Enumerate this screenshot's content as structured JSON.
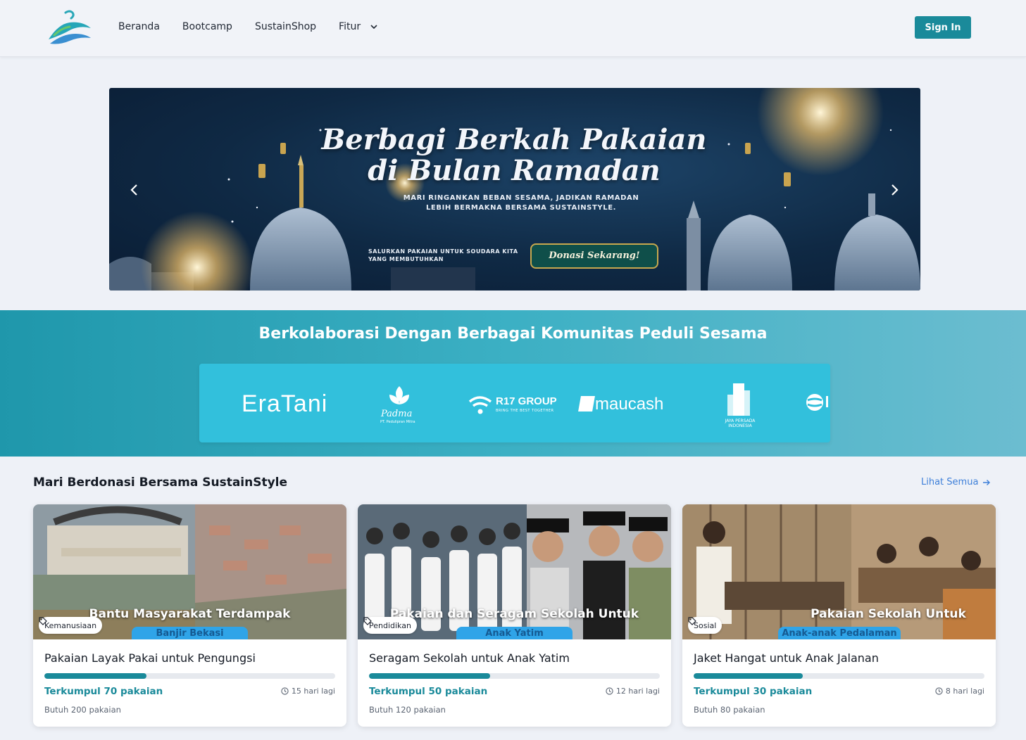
{
  "nav": {
    "links": [
      "Beranda",
      "Bootcamp",
      "SustainShop"
    ],
    "dropdown": "Fitur",
    "signin": "Sign In",
    "brand_color": "#1a8a9a"
  },
  "banner": {
    "title": "Berbagi Berkah Pakaian di Bulan Ramadan",
    "subtitle": "MARI RINGANKAN BEBAN SESAMA, JADIKAN RAMADAN LEBIH BERMAKNA BERSAMA SUSTAINSTYLE.",
    "small_text": "SALURKAN PAKAIAN UNTUK SOUDARA KITA YANG MEMBUTUHKAN",
    "cta": "Donasi Sekarang!",
    "prev_icon": "chevron-left-icon",
    "next_icon": "chevron-right-icon"
  },
  "collab": {
    "title": "Berkolaborasi Dengan Berbagai Komunitas Peduli Sesama",
    "partners": {
      "eratani": "EraTani",
      "padma": "Padma",
      "padma_sub": "PT. Pedulipran Mitra",
      "r17": "R17 GROUP",
      "r17_sub": "BRING THE BEST TOGETHER",
      "maucash": "maucash",
      "jaya": "JAYA PERSADA INDONESIA"
    }
  },
  "donation": {
    "title": "Mari Berdonasi Bersama SustainStyle",
    "see_all": "Lihat Semua",
    "cards": [
      {
        "tag": "Kemanusiaan",
        "image_caption": "Bantu Masyarakat Terdampak",
        "image_caption2": "Banjir Bekasi",
        "title": "Pakaian Layak Pakai untuk Pengungsi",
        "progress": 0.35,
        "collected": "Terkumpul 70 pakaian",
        "days_left": "15 hari lagi",
        "need": "Butuh 200 pakaian"
      },
      {
        "tag": "Pendidikan",
        "image_caption": "Pakaian dan Seragam Sekolah Untuk",
        "image_caption2": "Anak Yatim",
        "title": "Seragam Sekolah untuk Anak Yatim",
        "progress": 0.4167,
        "collected": "Terkumpul 50 pakaian",
        "days_left": "12 hari lagi",
        "need": "Butuh 120 pakaian"
      },
      {
        "tag": "Sosial",
        "image_caption": "Pakaian Sekolah Untuk",
        "image_caption2": "Anak-anak Pedalaman",
        "title": "Jaket Hangat untuk Anak Jalanan",
        "progress": 0.375,
        "collected": "Terkumpul 30 pakaian",
        "days_left": "8 hari lagi",
        "need": "Butuh 80 pakaian"
      }
    ]
  }
}
